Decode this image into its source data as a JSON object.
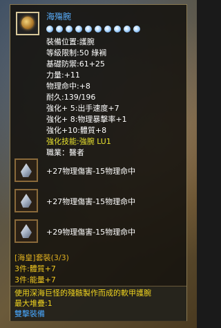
{
  "item": {
    "name": "海殤腕",
    "icon": "bracelet-gem-icon",
    "star_count": 10,
    "stats": [
      {
        "text": "裝備位置:護腕",
        "color": "white"
      },
      {
        "text": "等級限制:50   綠裥",
        "color": "white"
      },
      {
        "text": "基礎防禦:61+25",
        "color": "white"
      },
      {
        "text": "力量:+11",
        "color": "white"
      },
      {
        "text": "物理命中:+8",
        "color": "white"
      },
      {
        "text": "耐久:139/196",
        "color": "white"
      },
      {
        "text": "強化+ 5:出手速度+7",
        "color": "white"
      },
      {
        "text": "強化+ 8:物理暴擊率+1",
        "color": "white"
      },
      {
        "text": "強化+10:體質+8",
        "color": "white"
      },
      {
        "text": "強化技能:強腕   LU1",
        "color": "yellow"
      },
      {
        "text": "職業：醫者",
        "color": "white"
      }
    ],
    "slots": [
      {
        "icon": "crystal-icon",
        "text": "+27物理傷害-15物理命中"
      },
      {
        "icon": "crystal-icon",
        "text": "+27物理傷害-15物理命中"
      },
      {
        "icon": "crystal-icon",
        "text": "+29物理傷害-15物理命中"
      }
    ],
    "set": {
      "name": "[海皇]套裝(3/3)",
      "bonuses": [
        "3件:體質+7",
        "3件:能量+7"
      ]
    },
    "description": {
      "line1": "使用深海巨怪的殘骸製作而成的軟甲護腕",
      "line2": "最大堆疊:1",
      "link": "雙擊裝備"
    }
  },
  "colors": {
    "title": "#5ab0ff",
    "set": "#e0b020",
    "description": "#f0d420",
    "link": "#48a8ff"
  }
}
